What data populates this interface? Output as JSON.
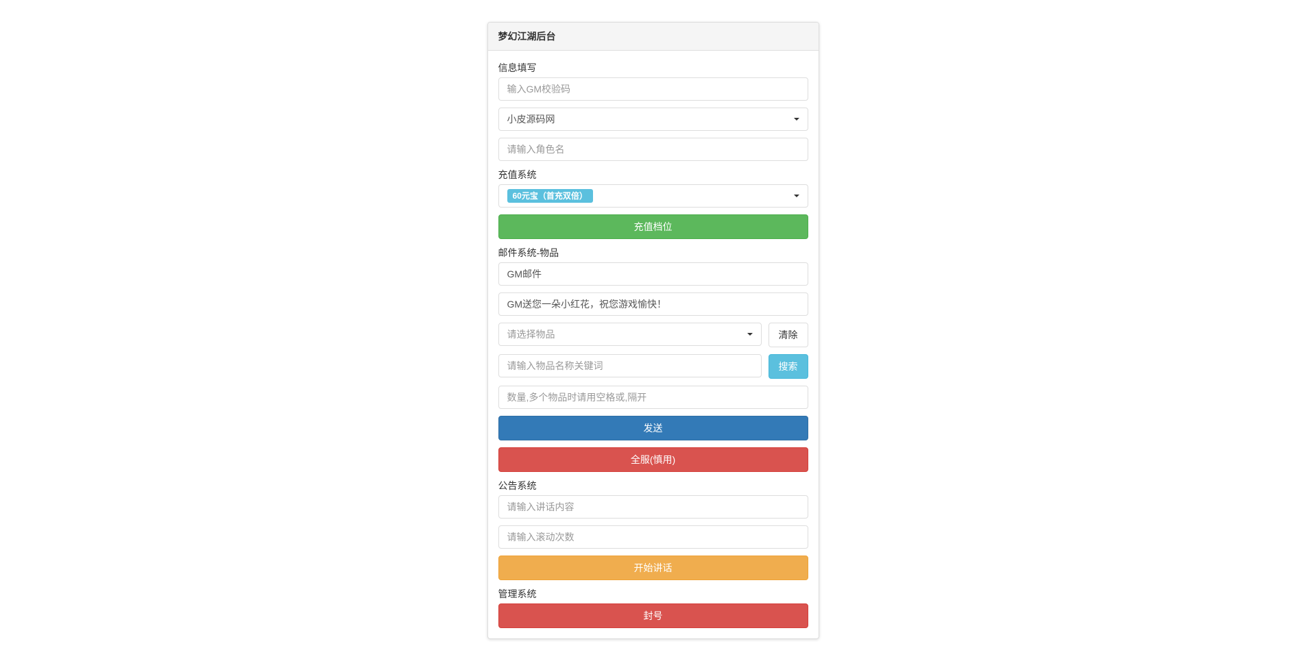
{
  "panel": {
    "title": "梦幻江湖后台"
  },
  "info": {
    "label": "信息填写",
    "gm_code_placeholder": "输入GM校验码",
    "server_selected": "小皮源码网",
    "role_name_placeholder": "请输入角色名"
  },
  "recharge": {
    "label": "充值系统",
    "tier_badge": "60元宝（首充双倍）",
    "button": "充值档位"
  },
  "mail": {
    "label": "邮件系统-物品",
    "title_value": "GM邮件",
    "content_value": "GM送您一朵小红花，祝您游戏愉快！",
    "item_select_placeholder": "请选择物品",
    "clear_button": "清除",
    "item_keyword_placeholder": "请输入物品名称关键词",
    "search_button": "搜索",
    "quantity_placeholder": "数量,多个物品时请用空格或,隔开",
    "send_button": "发送",
    "all_server_button": "全服(慎用)"
  },
  "announce": {
    "label": "公告系统",
    "content_placeholder": "请输入讲话内容",
    "scroll_placeholder": "请输入滚动次数",
    "start_button": "开始讲话"
  },
  "admin": {
    "label": "管理系统",
    "ban_button": "封号"
  }
}
